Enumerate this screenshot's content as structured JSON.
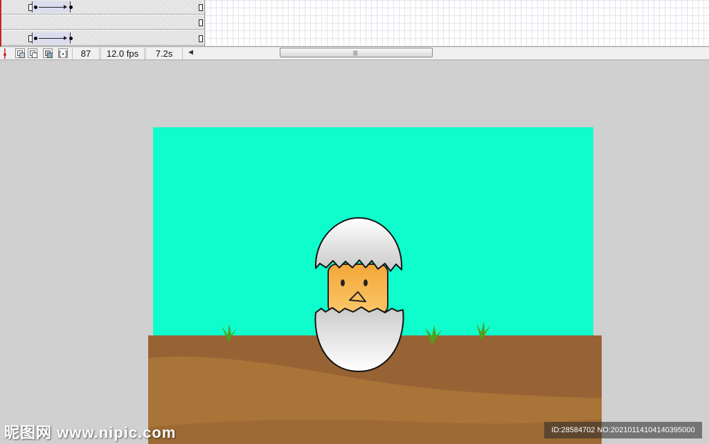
{
  "toolbar": {
    "current_frame": "87",
    "frame_rate": "12.0 fps",
    "elapsed_time": "7.2s"
  },
  "colors": {
    "sky": "#0ffdcc",
    "ground": "#976234",
    "ground_light": "#a97438",
    "chick": "#f5b24a",
    "grass": "#4fa01c",
    "workspace": "#d0d0d0"
  },
  "watermark": {
    "logo": "昵图网 www.nipic.com",
    "id_text": "ID:28584702 NO:20210114104140395000"
  }
}
